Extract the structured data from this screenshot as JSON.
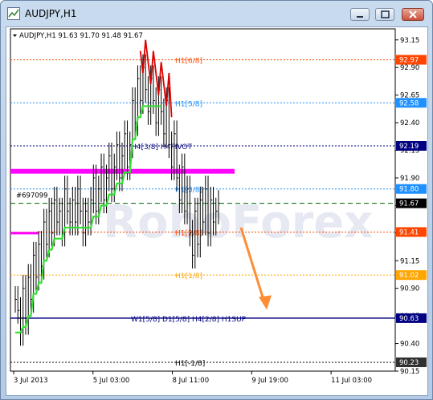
{
  "window": {
    "title": "AUDJPY,H1"
  },
  "chart": {
    "header": "AUDJPY,H1  91.63 91.70 91.48 91.67",
    "object_label": "#697099",
    "watermark": "RoboForex"
  },
  "colors": {
    "ladder": "#33dd33",
    "magenta": "#ff00ff",
    "navy": "#000080",
    "down": "#dd0000",
    "arrow": "#ff8c33",
    "bars": "#000000"
  },
  "chart_data": {
    "type": "bar",
    "symbol": "AUDJPY",
    "timeframe": "H1",
    "ylim": [
      90.15,
      93.25
    ],
    "y_ticks": [
      "93.15",
      "92.90",
      "92.65",
      "92.40",
      "92.15",
      "91.90",
      "91.65",
      "91.40",
      "91.15",
      "90.90",
      "90.65",
      "90.40",
      "90.15"
    ],
    "x_ticks": [
      "3 Jul 2013",
      "5 Jul 03:00",
      "8 Jul 11:00",
      "9 Jul 19:00",
      "11 Jul 03:00"
    ],
    "levels": [
      {
        "label": "H1[6/8]",
        "value": 92.97,
        "price": "92.97",
        "color": "#ff4500",
        "box": "#ff4500",
        "style": "dotted"
      },
      {
        "label": "H1[5/8]",
        "value": 92.58,
        "price": "92.58",
        "color": "#1e90ff",
        "box": "#1e90ff",
        "style": "dotted"
      },
      {
        "label": "H4[3/8] H4PIVOT",
        "value": 92.19,
        "price": "92.19",
        "color": "#000080",
        "box": "#000080",
        "style": "dotted"
      },
      {
        "label": "H1[3/8]",
        "value": 91.8,
        "price": "91.80",
        "color": "#1e90ff",
        "box": "#1e90ff",
        "style": "dotted"
      },
      {
        "label": "",
        "value": 91.67,
        "price": "91.67",
        "color": "#006400",
        "box": "#000000",
        "style": "dashed"
      },
      {
        "label": "H1[2/8]",
        "value": 91.41,
        "price": "91.41",
        "color": "#ff4500",
        "box": "#ff4500",
        "style": "dotted"
      },
      {
        "label": "H1[1/8]",
        "value": 91.02,
        "price": "91.02",
        "color": "#ffa500",
        "box": "#ffa500",
        "style": "dotted"
      },
      {
        "label": "W1[5/8] D1[5/8] H4[2/8] H1SUP",
        "value": 90.63,
        "price": "90.63",
        "color": "#000080",
        "box": "#000080",
        "style": "solid"
      },
      {
        "label": "H1[-1/8]",
        "value": 90.23,
        "price": "90.23",
        "color": "#000000",
        "box": "#303030",
        "style": "dotted"
      }
    ],
    "magenta_levels": [
      91.97,
      91.4
    ],
    "series": [
      {
        "values": [
          90.8,
          90.7,
          90.5,
          90.9,
          90.6,
          91.0,
          90.8,
          91.2,
          91.0,
          91.3,
          91.1,
          91.5,
          91.3,
          91.6,
          91.4,
          91.7,
          91.5,
          91.6,
          91.4,
          91.8,
          91.6,
          91.5,
          91.7,
          91.5,
          91.8,
          91.6,
          91.4,
          91.6,
          91.5,
          91.7,
          91.9,
          91.6,
          91.8,
          92.0,
          91.7,
          91.9,
          92.1,
          91.8,
          92.0,
          92.2,
          91.9,
          92.1,
          92.3,
          92.0,
          92.2,
          92.6,
          92.4,
          92.8,
          92.6,
          92.9,
          92.7,
          92.5,
          92.8,
          92.6,
          92.4,
          92.7,
          92.5,
          92.3,
          92.6,
          92.2,
          92.0,
          92.3,
          91.9,
          91.7,
          92.0,
          91.6,
          91.8,
          91.4,
          91.2,
          91.6,
          91.3,
          91.7,
          91.5,
          91.8,
          91.4,
          91.7,
          91.5,
          91.6,
          91.67
        ]
      }
    ]
  }
}
